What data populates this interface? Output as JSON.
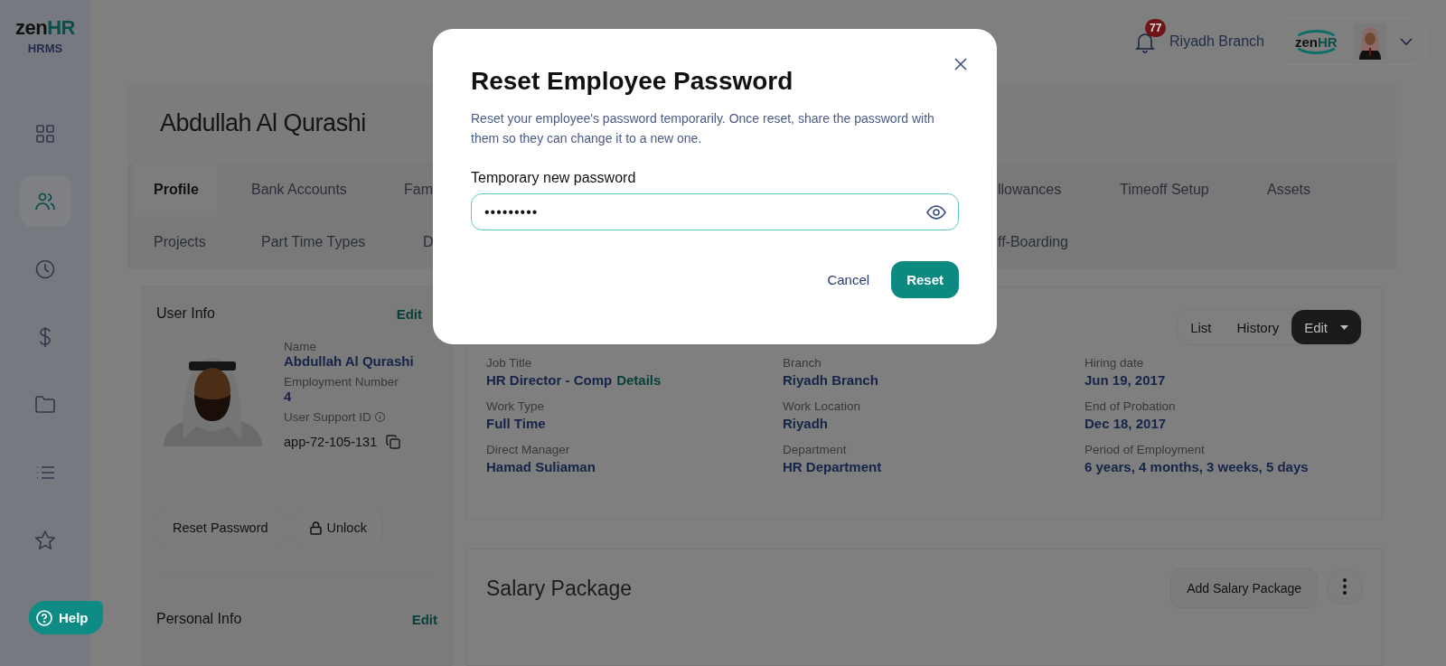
{
  "logo": {
    "brand": "zen",
    "brand_accent": "HR",
    "product": "HRMS"
  },
  "sidebar": {
    "items": [
      {
        "kind": "dashboard",
        "selected": false
      },
      {
        "kind": "people",
        "selected": true
      },
      {
        "kind": "clock",
        "selected": false
      },
      {
        "kind": "dollar",
        "selected": false
      },
      {
        "kind": "folder",
        "selected": false
      },
      {
        "kind": "list",
        "selected": false
      },
      {
        "kind": "star",
        "selected": false
      }
    ]
  },
  "help_button": {
    "label": "Help"
  },
  "header": {
    "notification_count": "77",
    "branch": "Riyadh Branch",
    "company_logo": {
      "brand": "zen",
      "brand_accent": "HR"
    }
  },
  "employee_name": "Abdullah Al Qurashi",
  "tabs": [
    [
      {
        "label": "Profile",
        "selected": true
      },
      {
        "label": "Bank Accounts",
        "selected": false
      },
      {
        "label": "Fam",
        "selected": false
      },
      {
        "label": "llowances",
        "selected": false
      },
      {
        "label": "Timeoff Setup",
        "selected": false
      },
      {
        "label": "Assets",
        "selected": false
      }
    ],
    [
      {
        "label": "Projects",
        "selected": false
      },
      {
        "label": "Part Time Types",
        "selected": false
      },
      {
        "label": "D",
        "selected": false
      },
      {
        "label": "ff-Boarding",
        "selected": false
      }
    ]
  ],
  "user_info": {
    "title": "User Info",
    "edit": "Edit",
    "fields": [
      {
        "label": "Name",
        "value": "Abdullah Al Qurashi"
      },
      {
        "label": "Employment Number",
        "value": "4"
      }
    ],
    "support_id": {
      "label": "User Support ID",
      "value": "app-72-105-131"
    },
    "buttons": [
      {
        "label": "Reset Password",
        "kind": "plain"
      },
      {
        "label": "Unlock",
        "kind": "lock"
      }
    ]
  },
  "personal_info": {
    "title": "Personal Info",
    "edit": "Edit"
  },
  "job_card": {
    "views": [
      {
        "label": "List",
        "selected": false
      },
      {
        "label": "History",
        "selected": false
      },
      {
        "label": "Edit",
        "selected": true
      }
    ],
    "fields": [
      {
        "label": "Job Title",
        "value": "HR Director - Comp",
        "link": "Details"
      },
      {
        "label": "Branch",
        "value": "Riyadh Branch"
      },
      {
        "label": "Hiring date",
        "value": "Jun 19, 2017"
      },
      {
        "label": "Work Type",
        "value": "Full Time"
      },
      {
        "label": "Work Location",
        "value": "Riyadh"
      },
      {
        "label": "End of Probation",
        "value": "Dec 18, 2017"
      },
      {
        "label": "Direct Manager",
        "value": "Hamad Suliaman"
      },
      {
        "label": "Department",
        "value": "HR Department"
      },
      {
        "label": "Period of Employment",
        "value": "6 years, 4 months, 3 weeks, 5 days"
      }
    ]
  },
  "salary_package": {
    "title": "Salary Package",
    "add_button": "Add Salary Package"
  },
  "modal": {
    "title": "Reset Employee Password",
    "description": "Reset your employee's password temporarily. Once reset, share the password with them so they can change it to a new one.",
    "field_label": "Temporary new password",
    "password": "•••••••••",
    "cancel": "Cancel",
    "confirm": "Reset"
  }
}
